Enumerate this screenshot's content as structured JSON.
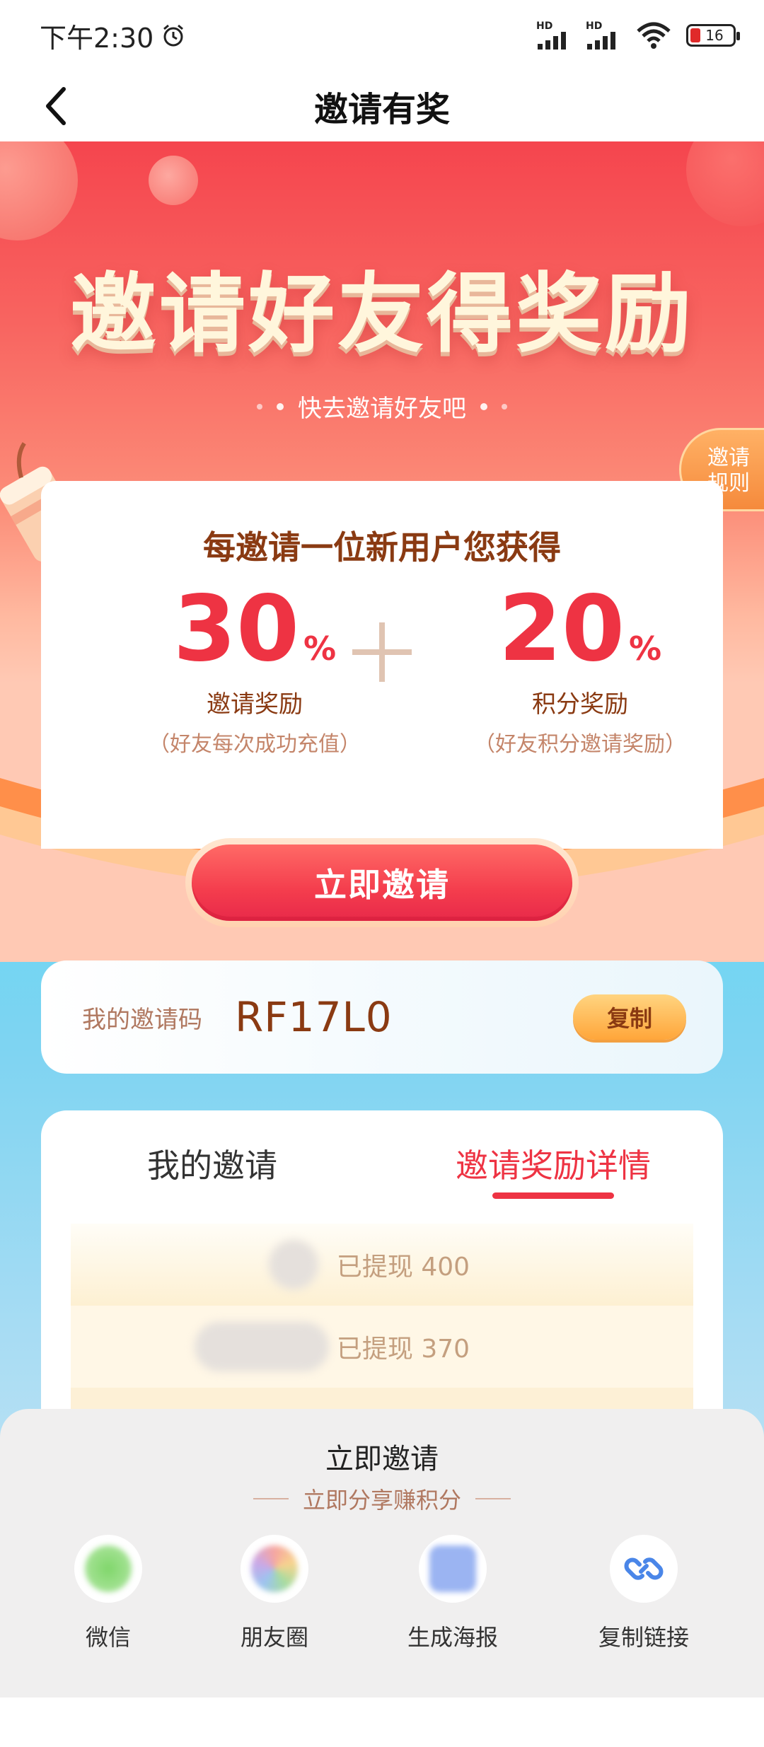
{
  "status": {
    "time": "下午2:30",
    "hd1": "HD",
    "hd2": "HD",
    "battery": "16"
  },
  "nav": {
    "title": "邀请有奖"
  },
  "hero": {
    "headline": "邀请好友得奖励",
    "subline": "快去邀请好友吧",
    "rules_label": "邀请\n规则"
  },
  "reward": {
    "title": "每邀请一位新用户您获得",
    "left": {
      "value": "30",
      "unit": "%",
      "label": "邀请奖励",
      "note": "（好友每次成功充值）"
    },
    "right": {
      "value": "20",
      "unit": "%",
      "label": "积分奖励",
      "note": "（好友积分邀请奖励）"
    },
    "button": "立即邀请"
  },
  "invite_code": {
    "label": "我的邀请码",
    "code": "RF17L0",
    "copy_label": "复制"
  },
  "tabs": {
    "items": [
      {
        "label": "我的邀请"
      },
      {
        "label": "邀请奖励详情"
      }
    ],
    "active_index": 1,
    "rows": [
      {
        "status": "已提现 400"
      },
      {
        "status": "已提现 370"
      }
    ]
  },
  "share_sheet": {
    "title": "立即邀请",
    "subtitle": "立即分享赚积分",
    "options": [
      {
        "label": "微信",
        "icon": "wechat-icon"
      },
      {
        "label": "朋友圈",
        "icon": "moments-icon"
      },
      {
        "label": "生成海报",
        "icon": "poster-icon"
      },
      {
        "label": "复制链接",
        "icon": "link-icon"
      }
    ]
  },
  "colors": {
    "accent": "#ee3343",
    "brown": "#8a3a12",
    "hero_top": "#f5454e",
    "lower_bg": "#5fd7f4"
  }
}
